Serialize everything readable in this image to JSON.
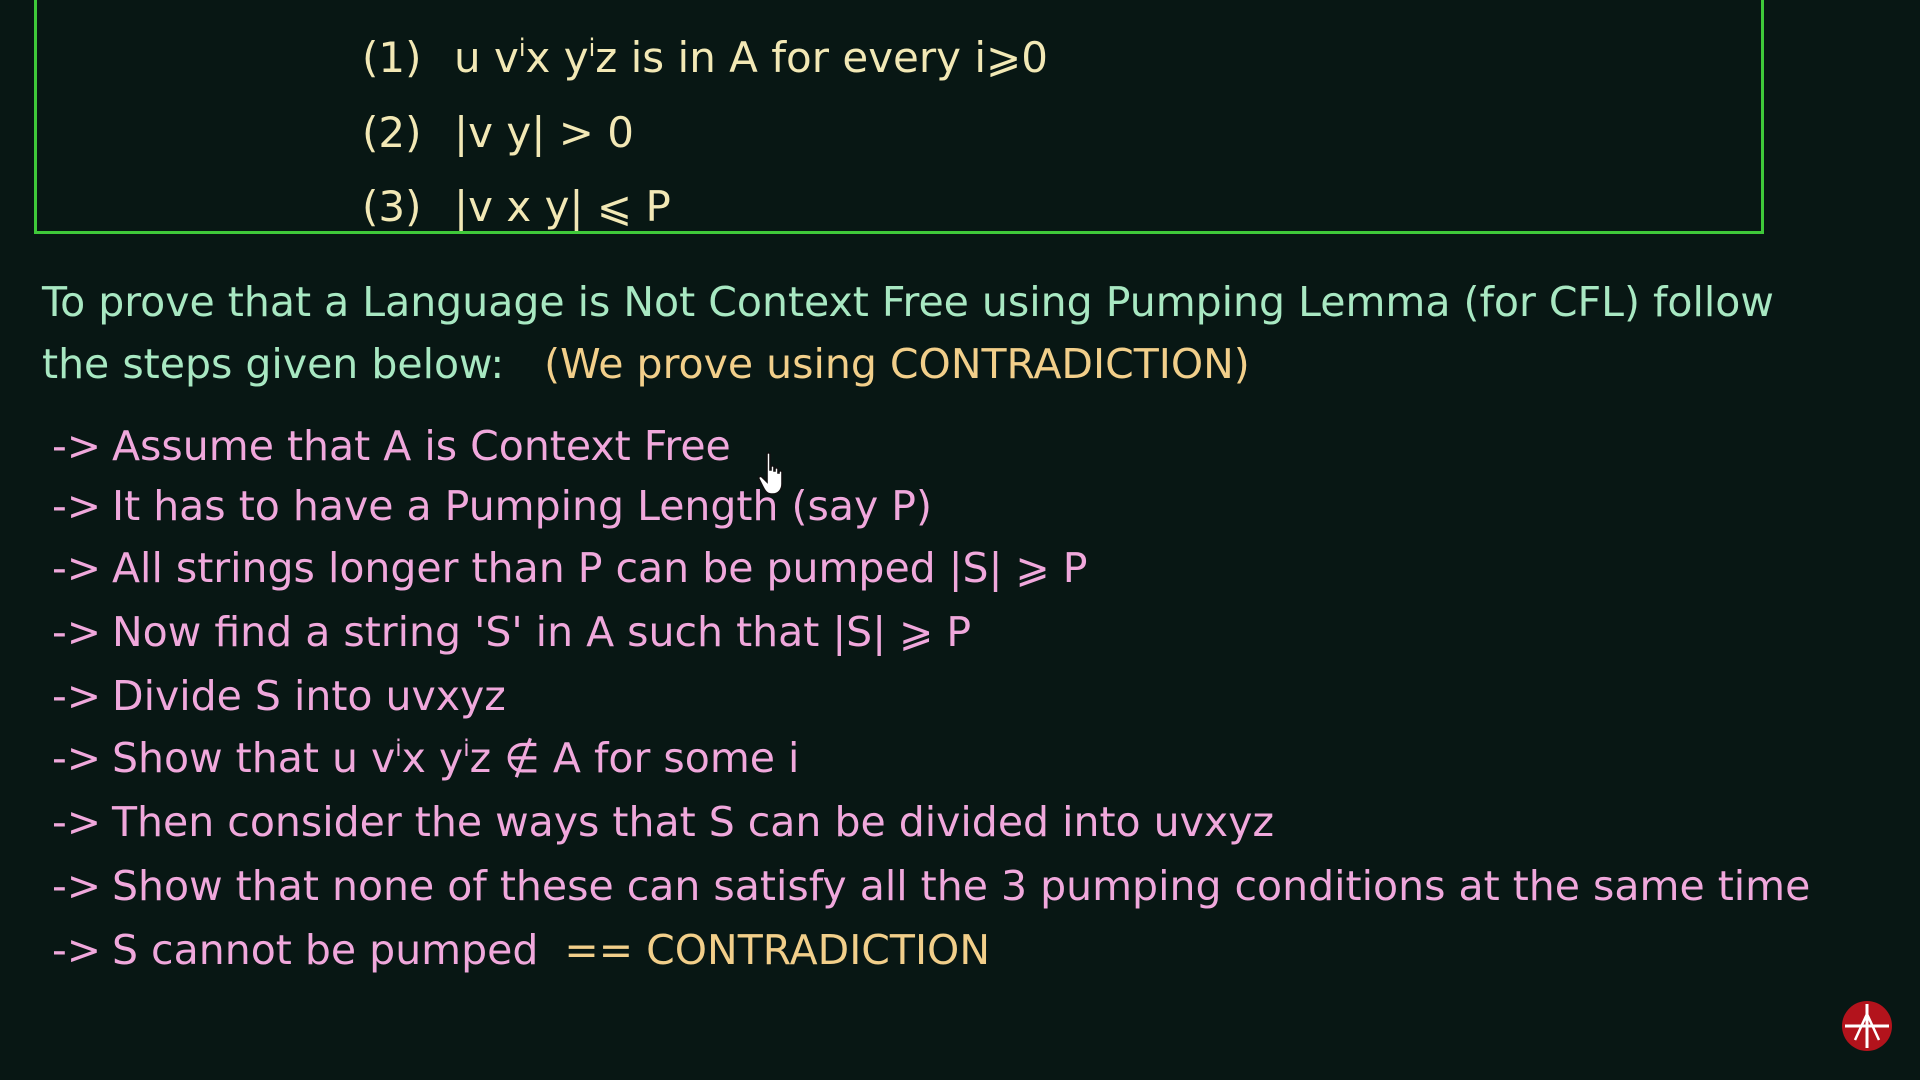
{
  "conditions": [
    {
      "num": "(1)",
      "pre": "u v",
      "sup1": "i",
      "mid": "x y",
      "sup2": "i",
      "post": "z   is in A for every  i⩾0"
    },
    {
      "num": "(2)",
      "text": "|v y| > 0"
    },
    {
      "num": "(3)",
      "text": "|v x y| ⩽ P"
    }
  ],
  "intro": {
    "line1": "To prove that a Language is Not Context Free using Pumping Lemma (for CFL) follow",
    "line2": "the steps given below:",
    "note": "(We prove using CONTRADICTION)"
  },
  "steps": [
    {
      "arrow": "->",
      "text": "Assume that A is Context Free"
    },
    {
      "arrow": "->",
      "text": "It has to have a Pumping Length (say P)"
    },
    {
      "arrow": "->",
      "text": "All strings longer than P can be pumped   |S| ⩾ P"
    },
    {
      "arrow": "->",
      "text": "Now find a string 'S' in A such that   |S| ⩾ P"
    },
    {
      "arrow": "->",
      "text": "Divide S into uvxyz"
    },
    {
      "arrow": "->",
      "pre": "Show that u v",
      "sup1": "i",
      "mid": "x y",
      "sup2": "i",
      "post": "z ∉ A for some i"
    },
    {
      "arrow": "->",
      "text": "Then consider the ways that S can be divided into uvxyz"
    },
    {
      "arrow": "->",
      "text": "Show that none of these can satisfy all the 3 pumping conditions at the same time"
    },
    {
      "arrow": "->",
      "text": "S cannot be pumped",
      "highlight": "== CONTRADICTION"
    }
  ],
  "icons": {
    "cursor": "hand-pointer-icon",
    "logo": "channel-logo-icon"
  },
  "colors": {
    "background": "#081714",
    "box_border": "#3fc93a",
    "conditions": "#f2e8b5",
    "intro": "#a8e8c2",
    "note": "#f2cf8a",
    "steps": "#f0a8dc",
    "logo": "#b3131c"
  }
}
